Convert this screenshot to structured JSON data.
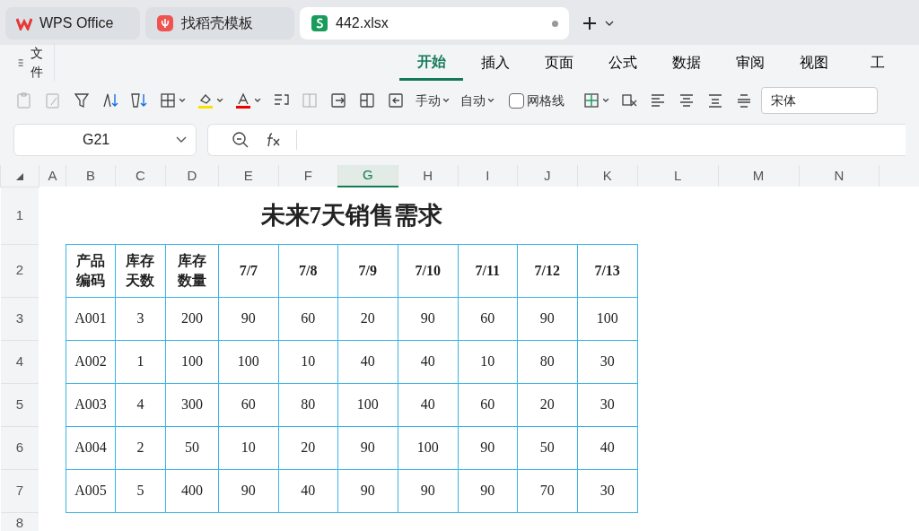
{
  "app_tabs": [
    {
      "label": "WPS Office",
      "kind": "wps",
      "selected": false
    },
    {
      "label": "找稻壳模板",
      "kind": "docer",
      "selected": false
    },
    {
      "label": "442.xlsx",
      "kind": "sheet",
      "selected": true
    }
  ],
  "file_menu": "文件",
  "ribbon_tabs": [
    {
      "label": "开始",
      "selected": true
    },
    {
      "label": "插入",
      "selected": false
    },
    {
      "label": "页面",
      "selected": false
    },
    {
      "label": "公式",
      "selected": false
    },
    {
      "label": "数据",
      "selected": false
    },
    {
      "label": "审阅",
      "selected": false
    },
    {
      "label": "视图",
      "selected": false
    },
    {
      "label": "工",
      "selected": false
    }
  ],
  "toolbar": {
    "row_height_mode": "手动",
    "col_width_mode": "自动",
    "gridlines": {
      "label": "网格线",
      "checked": false
    },
    "font": "宋体"
  },
  "name_box": "G21",
  "columns": [
    {
      "label": "A",
      "selected": false
    },
    {
      "label": "B",
      "selected": false
    },
    {
      "label": "C",
      "selected": false
    },
    {
      "label": "D",
      "selected": false
    },
    {
      "label": "E",
      "selected": false
    },
    {
      "label": "F",
      "selected": false
    },
    {
      "label": "G",
      "selected": true
    },
    {
      "label": "H",
      "selected": false
    },
    {
      "label": "I",
      "selected": false
    },
    {
      "label": "J",
      "selected": false
    },
    {
      "label": "K",
      "selected": false
    },
    {
      "label": "L",
      "selected": false
    },
    {
      "label": "M",
      "selected": false
    },
    {
      "label": "N",
      "selected": false
    }
  ],
  "row_numbers": [
    "1",
    "2",
    "3",
    "4",
    "5",
    "6",
    "7",
    "8"
  ],
  "sheet_title": "未来7天销售需求",
  "table": {
    "columns": [
      "产品编码",
      "库存天数",
      "库存数量",
      "7/7",
      "7/8",
      "7/9",
      "7/10",
      "7/11",
      "7/12",
      "7/13"
    ],
    "rows": [
      [
        "A001",
        "3",
        "200",
        "90",
        "60",
        "20",
        "90",
        "60",
        "90",
        "100"
      ],
      [
        "A002",
        "1",
        "100",
        "100",
        "10",
        "40",
        "40",
        "10",
        "80",
        "30"
      ],
      [
        "A003",
        "4",
        "300",
        "60",
        "80",
        "100",
        "40",
        "60",
        "20",
        "30"
      ],
      [
        "A004",
        "2",
        "50",
        "10",
        "20",
        "90",
        "100",
        "90",
        "50",
        "40"
      ],
      [
        "A005",
        "5",
        "400",
        "90",
        "40",
        "90",
        "90",
        "90",
        "70",
        "30"
      ]
    ]
  }
}
